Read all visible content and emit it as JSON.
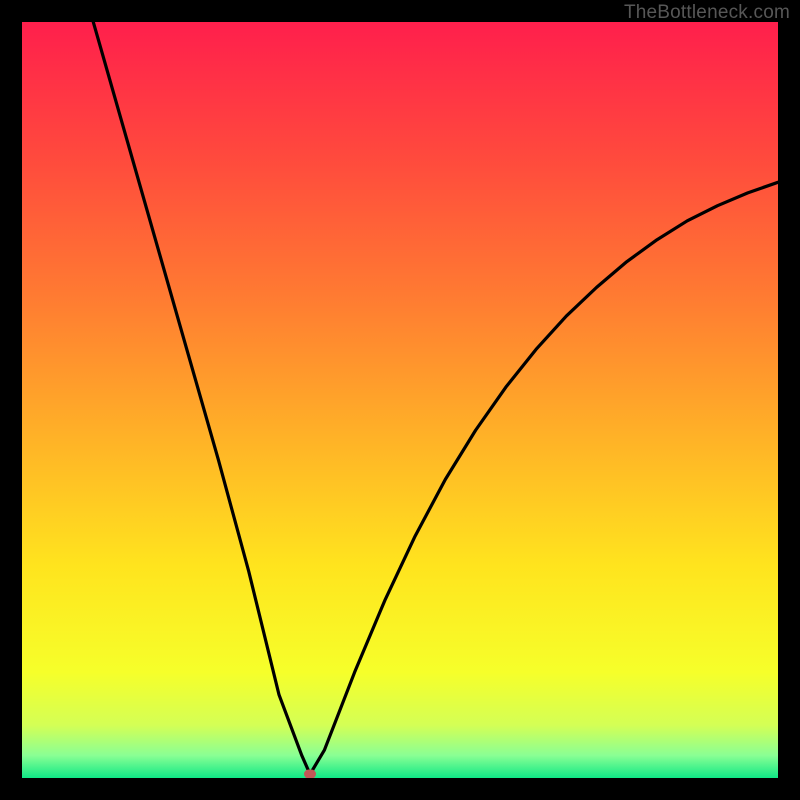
{
  "watermark": "TheBottleneck.com",
  "chart_data": {
    "type": "line",
    "title": "",
    "xlabel": "",
    "ylabel": "",
    "xlim": [
      0,
      1
    ],
    "ylim": [
      0,
      1
    ],
    "grid": false,
    "legend": false,
    "series": [
      {
        "name": "curve",
        "color": "#000000",
        "x": [
          0.0,
          0.02,
          0.06,
          0.1,
          0.14,
          0.18,
          0.22,
          0.26,
          0.3,
          0.34,
          0.37,
          0.381,
          0.4,
          0.44,
          0.48,
          0.52,
          0.56,
          0.6,
          0.64,
          0.68,
          0.72,
          0.76,
          0.8,
          0.84,
          0.88,
          0.92,
          0.96,
          1.0
        ],
        "y": [
          1.33,
          1.26,
          1.12,
          0.98,
          0.84,
          0.7,
          0.56,
          0.42,
          0.273,
          0.11,
          0.03,
          0.005,
          0.037,
          0.14,
          0.235,
          0.32,
          0.395,
          0.46,
          0.517,
          0.567,
          0.611,
          0.649,
          0.683,
          0.712,
          0.737,
          0.757,
          0.774,
          0.788
        ]
      }
    ],
    "background_gradient": {
      "stops": [
        {
          "offset": 0.0,
          "color": "#ff1f4c"
        },
        {
          "offset": 0.18,
          "color": "#ff4a3d"
        },
        {
          "offset": 0.36,
          "color": "#ff7a32"
        },
        {
          "offset": 0.55,
          "color": "#ffb227"
        },
        {
          "offset": 0.72,
          "color": "#ffe41e"
        },
        {
          "offset": 0.86,
          "color": "#f6ff2a"
        },
        {
          "offset": 0.93,
          "color": "#d4ff55"
        },
        {
          "offset": 0.97,
          "color": "#8aff94"
        },
        {
          "offset": 1.0,
          "color": "#10e886"
        }
      ]
    },
    "marker": {
      "x": 0.381,
      "y": 0.005,
      "color": "#c15757"
    }
  }
}
